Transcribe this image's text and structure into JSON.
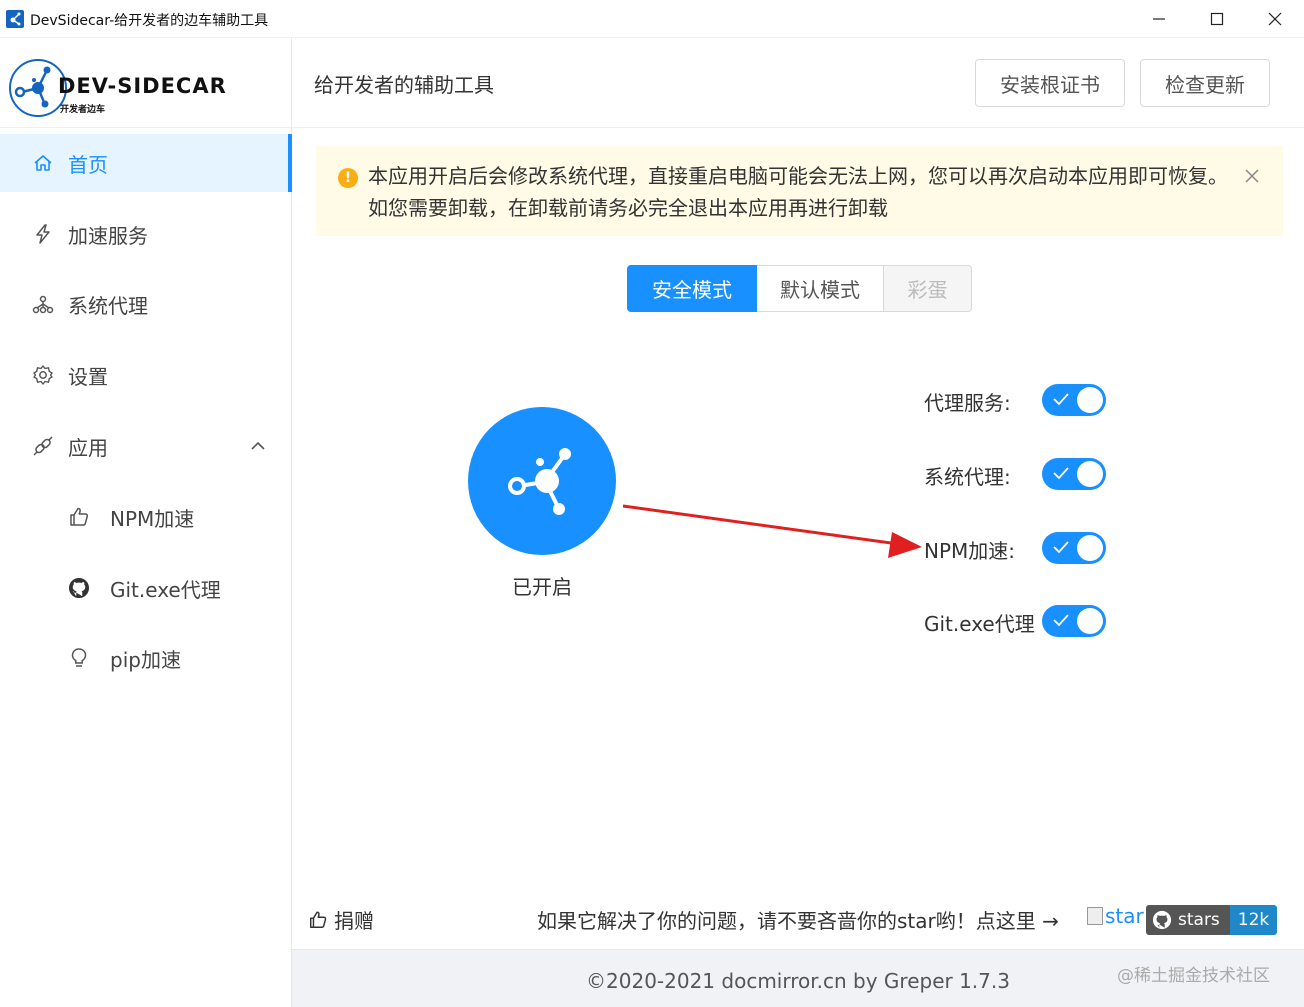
{
  "window": {
    "title": "DevSidecar-给开发者的边车辅助工具",
    "minimize_icon": "minimize-icon",
    "maximize_icon": "maximize-icon",
    "close_icon": "close-icon"
  },
  "logo": {
    "brand": "DEV-SIDECAR",
    "sub": "开发者边车"
  },
  "sidebar": {
    "items": [
      {
        "label": "首页",
        "icon": "home-icon",
        "active": true
      },
      {
        "label": "加速服务",
        "icon": "thunderbolt-icon"
      },
      {
        "label": "系统代理",
        "icon": "apartment-icon"
      },
      {
        "label": "设置",
        "icon": "gear-icon"
      },
      {
        "label": "应用",
        "icon": "api-icon",
        "expanded": true
      }
    ],
    "sub_items": [
      {
        "label": "NPM加速",
        "icon": "like-icon"
      },
      {
        "label": "Git.exe代理",
        "icon": "github-icon"
      },
      {
        "label": "pip加速",
        "icon": "bulb-icon"
      }
    ]
  },
  "header": {
    "title": "给开发者的辅助工具",
    "install_cert": "安装根证书",
    "check_update": "检查更新"
  },
  "alert": {
    "icon": "exclamation-icon",
    "text": "本应用开启后会修改系统代理，直接重启电脑可能会无法上网，您可以再次启动本应用即可恢复。如您需要卸载，在卸载前请务必完全退出本应用再进行卸载"
  },
  "modes": {
    "safe": "安全模式",
    "default": "默认模式",
    "easter_egg": "彩蛋",
    "selected": "安全模式"
  },
  "main_switch": {
    "state": "已开启",
    "icon": "sidecar-logo-icon"
  },
  "toggles": [
    {
      "label": "代理服务:",
      "on": true
    },
    {
      "label": "系统代理:",
      "on": true
    },
    {
      "label": "NPM加速:",
      "on": true
    },
    {
      "label": "Git.exe代理",
      "on": true
    }
  ],
  "colors": {
    "primary": "#1890ff",
    "alert_bg": "#fffbe6",
    "warning": "#faad14",
    "arrow": "#e02020"
  },
  "bottom": {
    "donate": "捐赠",
    "cta": "如果它解决了你的问题，请不要吝啬你的star哟！点这里 →",
    "star_alt": "star",
    "badge_label": "stars",
    "badge_count": "12k"
  },
  "footer": {
    "copyright": "©2020-2021 docmirror.cn by Greper 1.7.3",
    "watermark": "@稀土掘金技术社区"
  }
}
